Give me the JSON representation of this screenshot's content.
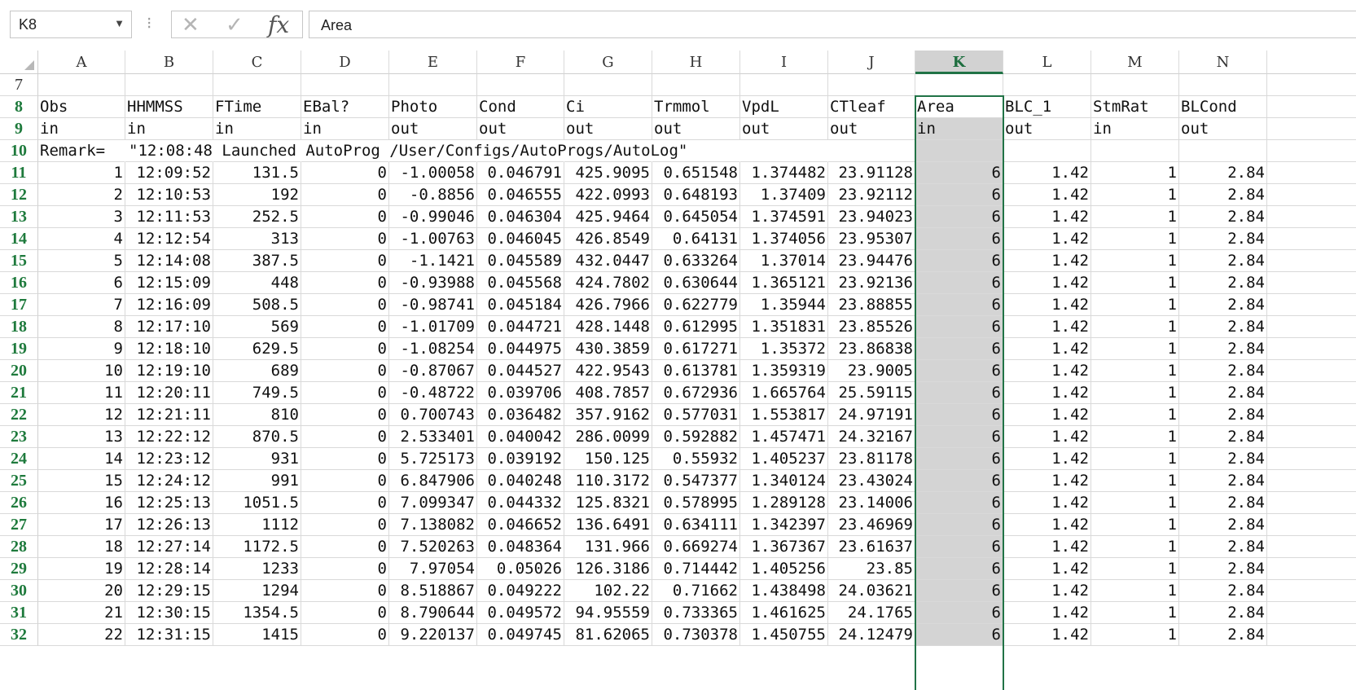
{
  "formula_bar": {
    "name_box": "K8",
    "cancel_icon": "✕",
    "enter_icon": "✓",
    "fx_label": "fx",
    "formula": "Area"
  },
  "selected_column": "K",
  "columns": [
    "A",
    "B",
    "C",
    "D",
    "E",
    "F",
    "G",
    "H",
    "I",
    "J",
    "K",
    "L",
    "M",
    "N"
  ],
  "rows": [
    {
      "num": "7",
      "cells": [
        "",
        "",
        "",
        "",
        "",
        "",
        "",
        "",
        "",
        "",
        "",
        "",
        "",
        ""
      ]
    },
    {
      "num": "8",
      "cells": [
        "Obs",
        "HHMMSS",
        "FTime",
        "EBal?",
        "Photo",
        "Cond",
        "Ci",
        "Trmmol",
        "VpdL",
        "CTleaf",
        "Area",
        "BLC_1",
        "StmRat",
        "BLCond"
      ]
    },
    {
      "num": "9",
      "cells": [
        "in",
        "in",
        "in",
        "in",
        "out",
        "out",
        "out",
        "out",
        "out",
        "out",
        "in",
        "out",
        "in",
        "out"
      ]
    },
    {
      "num": "10",
      "cells": [
        "Remark=",
        "\"12:08:48 Launched AutoProg /User/Configs/AutoProgs/AutoLog\"",
        "",
        "",
        "",
        "",
        "",
        "",
        "",
        "",
        "",
        "",
        "",
        ""
      ]
    },
    {
      "num": "11",
      "cells": [
        "1",
        "12:09:52",
        "131.5",
        "0",
        "-1.00058",
        "0.046791",
        "425.9095",
        "0.651548",
        "1.374482",
        "23.91128",
        "6",
        "1.42",
        "1",
        "2.84"
      ]
    },
    {
      "num": "12",
      "cells": [
        "2",
        "12:10:53",
        "192",
        "0",
        "-0.8856",
        "0.046555",
        "422.0993",
        "0.648193",
        "1.37409",
        "23.92112",
        "6",
        "1.42",
        "1",
        "2.84"
      ]
    },
    {
      "num": "13",
      "cells": [
        "3",
        "12:11:53",
        "252.5",
        "0",
        "-0.99046",
        "0.046304",
        "425.9464",
        "0.645054",
        "1.374591",
        "23.94023",
        "6",
        "1.42",
        "1",
        "2.84"
      ]
    },
    {
      "num": "14",
      "cells": [
        "4",
        "12:12:54",
        "313",
        "0",
        "-1.00763",
        "0.046045",
        "426.8549",
        "0.64131",
        "1.374056",
        "23.95307",
        "6",
        "1.42",
        "1",
        "2.84"
      ]
    },
    {
      "num": "15",
      "cells": [
        "5",
        "12:14:08",
        "387.5",
        "0",
        "-1.1421",
        "0.045589",
        "432.0447",
        "0.633264",
        "1.37014",
        "23.94476",
        "6",
        "1.42",
        "1",
        "2.84"
      ]
    },
    {
      "num": "16",
      "cells": [
        "6",
        "12:15:09",
        "448",
        "0",
        "-0.93988",
        "0.045568",
        "424.7802",
        "0.630644",
        "1.365121",
        "23.92136",
        "6",
        "1.42",
        "1",
        "2.84"
      ]
    },
    {
      "num": "17",
      "cells": [
        "7",
        "12:16:09",
        "508.5",
        "0",
        "-0.98741",
        "0.045184",
        "426.7966",
        "0.622779",
        "1.35944",
        "23.88855",
        "6",
        "1.42",
        "1",
        "2.84"
      ]
    },
    {
      "num": "18",
      "cells": [
        "8",
        "12:17:10",
        "569",
        "0",
        "-1.01709",
        "0.044721",
        "428.1448",
        "0.612995",
        "1.351831",
        "23.85526",
        "6",
        "1.42",
        "1",
        "2.84"
      ]
    },
    {
      "num": "19",
      "cells": [
        "9",
        "12:18:10",
        "629.5",
        "0",
        "-1.08254",
        "0.044975",
        "430.3859",
        "0.617271",
        "1.35372",
        "23.86838",
        "6",
        "1.42",
        "1",
        "2.84"
      ]
    },
    {
      "num": "20",
      "cells": [
        "10",
        "12:19:10",
        "689",
        "0",
        "-0.87067",
        "0.044527",
        "422.9543",
        "0.613781",
        "1.359319",
        "23.9005",
        "6",
        "1.42",
        "1",
        "2.84"
      ]
    },
    {
      "num": "21",
      "cells": [
        "11",
        "12:20:11",
        "749.5",
        "0",
        "-0.48722",
        "0.039706",
        "408.7857",
        "0.672936",
        "1.665764",
        "25.59115",
        "6",
        "1.42",
        "1",
        "2.84"
      ]
    },
    {
      "num": "22",
      "cells": [
        "12",
        "12:21:11",
        "810",
        "0",
        "0.700743",
        "0.036482",
        "357.9162",
        "0.577031",
        "1.553817",
        "24.97191",
        "6",
        "1.42",
        "1",
        "2.84"
      ]
    },
    {
      "num": "23",
      "cells": [
        "13",
        "12:22:12",
        "870.5",
        "0",
        "2.533401",
        "0.040042",
        "286.0099",
        "0.592882",
        "1.457471",
        "24.32167",
        "6",
        "1.42",
        "1",
        "2.84"
      ]
    },
    {
      "num": "24",
      "cells": [
        "14",
        "12:23:12",
        "931",
        "0",
        "5.725173",
        "0.039192",
        "150.125",
        "0.55932",
        "1.405237",
        "23.81178",
        "6",
        "1.42",
        "1",
        "2.84"
      ]
    },
    {
      "num": "25",
      "cells": [
        "15",
        "12:24:12",
        "991",
        "0",
        "6.847906",
        "0.040248",
        "110.3172",
        "0.547377",
        "1.340124",
        "23.43024",
        "6",
        "1.42",
        "1",
        "2.84"
      ]
    },
    {
      "num": "26",
      "cells": [
        "16",
        "12:25:13",
        "1051.5",
        "0",
        "7.099347",
        "0.044332",
        "125.8321",
        "0.578995",
        "1.289128",
        "23.14006",
        "6",
        "1.42",
        "1",
        "2.84"
      ]
    },
    {
      "num": "27",
      "cells": [
        "17",
        "12:26:13",
        "1112",
        "0",
        "7.138082",
        "0.046652",
        "136.6491",
        "0.634111",
        "1.342397",
        "23.46969",
        "6",
        "1.42",
        "1",
        "2.84"
      ]
    },
    {
      "num": "28",
      "cells": [
        "18",
        "12:27:14",
        "1172.5",
        "0",
        "7.520263",
        "0.048364",
        "131.966",
        "0.669274",
        "1.367367",
        "23.61637",
        "6",
        "1.42",
        "1",
        "2.84"
      ]
    },
    {
      "num": "29",
      "cells": [
        "19",
        "12:28:14",
        "1233",
        "0",
        "7.97054",
        "0.05026",
        "126.3186",
        "0.714442",
        "1.405256",
        "23.85",
        "6",
        "1.42",
        "1",
        "2.84"
      ]
    },
    {
      "num": "30",
      "cells": [
        "20",
        "12:29:15",
        "1294",
        "0",
        "8.518867",
        "0.049222",
        "102.22",
        "0.71662",
        "1.438498",
        "24.03621",
        "6",
        "1.42",
        "1",
        "2.84"
      ]
    },
    {
      "num": "31",
      "cells": [
        "21",
        "12:30:15",
        "1354.5",
        "0",
        "8.790644",
        "0.049572",
        "94.95559",
        "0.733365",
        "1.461625",
        "24.1765",
        "6",
        "1.42",
        "1",
        "2.84"
      ]
    },
    {
      "num": "32",
      "cells": [
        "22",
        "12:31:15",
        "1415",
        "0",
        "9.220137",
        "0.049745",
        "81.62065",
        "0.730378",
        "1.450755",
        "24.12479",
        "6",
        "1.42",
        "1",
        "2.84"
      ]
    }
  ]
}
